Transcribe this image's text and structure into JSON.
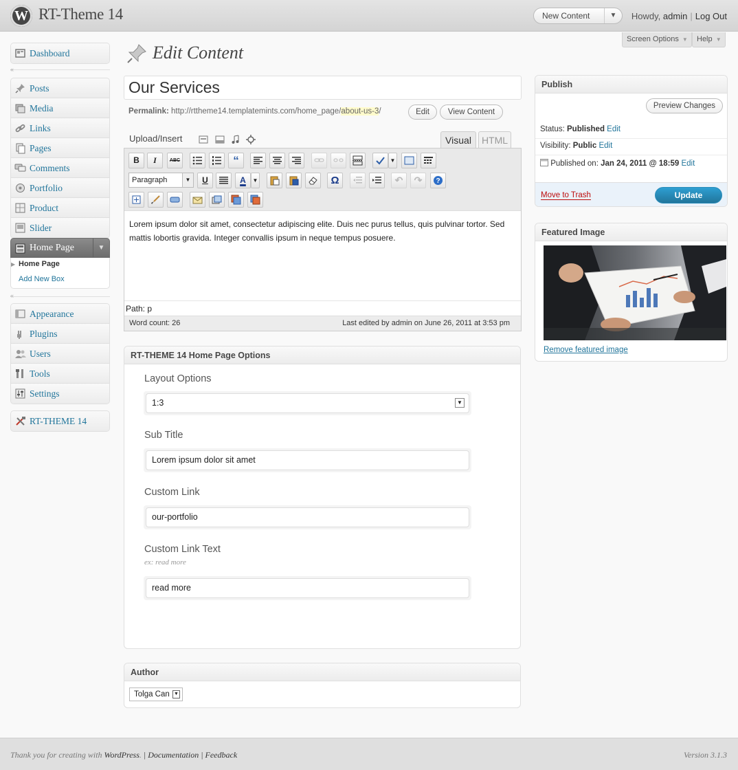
{
  "header": {
    "site_title": "RT-Theme 14",
    "favorite_action": "New Content",
    "howdy": "Howdy,",
    "username": "admin",
    "logout": "Log Out",
    "screen_options": "Screen Options",
    "help": "Help"
  },
  "menu": {
    "group1": [
      {
        "label": "Dashboard",
        "icon": "dashboard-icon"
      }
    ],
    "group2": [
      {
        "label": "Posts",
        "icon": "pushpin-icon"
      },
      {
        "label": "Media",
        "icon": "media-icon"
      },
      {
        "label": "Links",
        "icon": "links-icon"
      },
      {
        "label": "Pages",
        "icon": "pages-icon"
      },
      {
        "label": "Comments",
        "icon": "comments-icon"
      },
      {
        "label": "Portfolio",
        "icon": "portfolio-icon"
      },
      {
        "label": "Product",
        "icon": "product-icon"
      },
      {
        "label": "Slider",
        "icon": "slider-icon"
      }
    ],
    "home_page": {
      "label": "Home Page",
      "submenu": [
        "Home Page",
        "Add New Box"
      ]
    },
    "group3": [
      {
        "label": "Appearance",
        "icon": "appearance-icon"
      },
      {
        "label": "Plugins",
        "icon": "plugins-icon"
      },
      {
        "label": "Users",
        "icon": "users-icon"
      },
      {
        "label": "Tools",
        "icon": "tools-icon"
      },
      {
        "label": "Settings",
        "icon": "settings-icon"
      }
    ],
    "group4": [
      {
        "label": "RT-THEME 14",
        "icon": "rt-theme-icon"
      }
    ]
  },
  "page": {
    "title": "Edit Content",
    "post_title": "Our Services",
    "permalink_label": "Permalink:",
    "permalink_base": "http://rttheme14.templatemints.com/home_page/",
    "permalink_slug": "about-us-3",
    "permalink_end": "/",
    "edit_button": "Edit",
    "view_button": "View Content"
  },
  "editor": {
    "upload_insert": "Upload/Insert",
    "tab_visual": "Visual",
    "tab_html": "HTML",
    "format": "Paragraph",
    "content": "Lorem ipsum dolor sit amet, consectetur adipiscing elite. Duis nec purus tellus, quis pulvinar tortor. Sed mattis lobortis gravida. Integer convallis ipsum in neque tempus posuere.",
    "path": "Path: p",
    "word_count": "Word count: 26",
    "last_edited": "Last edited by admin on June 26, 2011 at 3:53 pm",
    "toolbar_glyphs": {
      "bold": "B",
      "italic": "I",
      "strike": "ABC",
      "quote": "“",
      "underline": "U",
      "omega": "Ω",
      "text_color": "A",
      "help": "?"
    }
  },
  "options_box": {
    "title": "RT-THEME 14 Home Page Options",
    "layout_label": "Layout Options",
    "layout_value": "1:3",
    "subtitle_label": "Sub Title",
    "subtitle_value": "Lorem ipsum dolor sit amet",
    "link_label": "Custom Link",
    "link_value": "our-portfolio",
    "link_text_label": "Custom Link Text",
    "link_text_hint": "ex: read more",
    "link_text_value": "read more"
  },
  "author_box": {
    "title": "Author",
    "author": "Tolga Can"
  },
  "publish_box": {
    "title": "Publish",
    "preview": "Preview Changes",
    "status_label": "Status:",
    "status_value": "Published",
    "visibility_label": "Visibility:",
    "visibility_value": "Public",
    "published_label": "Published on:",
    "published_value": "Jan 24, 2011 @ 18:59",
    "edit": "Edit",
    "trash": "Move to Trash",
    "update": "Update"
  },
  "featured_box": {
    "title": "Featured Image",
    "remove": "Remove featured image"
  },
  "footer": {
    "thanks_prefix": "Thank you for creating with",
    "wordpress": "WordPress",
    "dot": ".",
    "documentation": "Documentation",
    "feedback": "Feedback",
    "sep": "|",
    "version": "Version 3.1.3"
  },
  "colors": {
    "link": "#21759b",
    "update_button": "#21759b",
    "trash": "#bc0b0b",
    "header_bg": "#dcdcdc"
  }
}
